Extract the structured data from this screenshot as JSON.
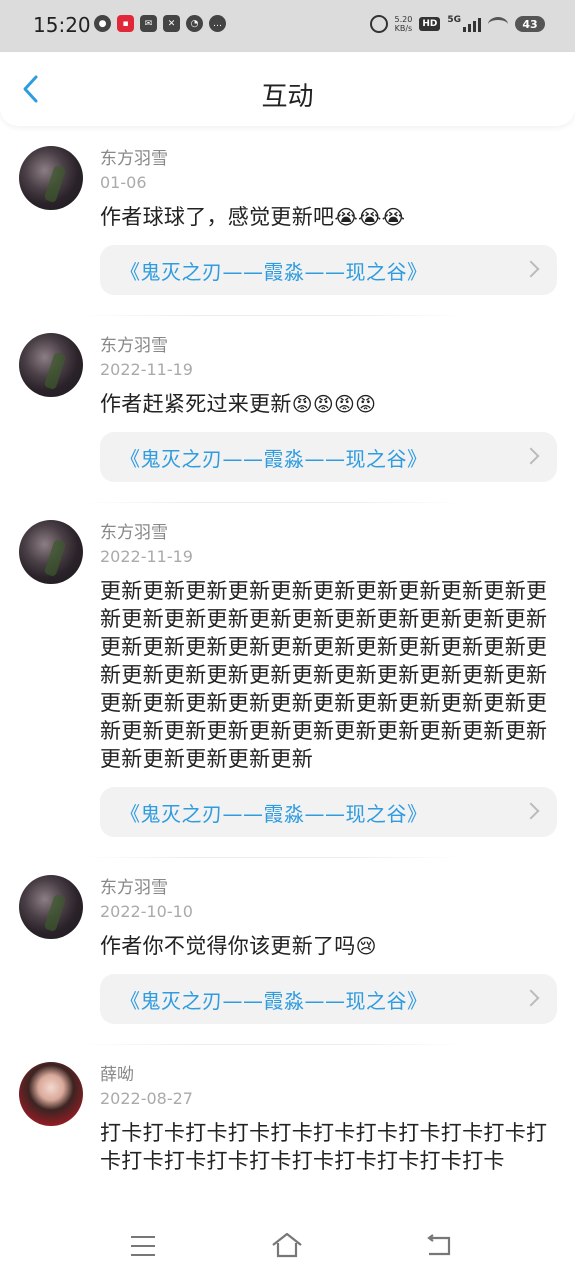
{
  "status": {
    "time": "15:20",
    "speed_value": "5.20",
    "speed_unit": "KB/s",
    "hd": "HD",
    "network": "5G",
    "battery": "43"
  },
  "header": {
    "title": "互动"
  },
  "comments": [
    {
      "username": "东方羽雪",
      "date": "01-06",
      "text": "作者球球了，感觉更新吧",
      "emoji": "😭😭😭",
      "book": "《鬼灭之刃——霞淼——现之谷》"
    },
    {
      "username": "东方羽雪",
      "date": "2022-11-19",
      "text": "作者赶紧死过来更新",
      "emoji": "😡😡😡😡",
      "book": "《鬼灭之刃——霞淼——现之谷》"
    },
    {
      "username": "东方羽雪",
      "date": "2022-11-19",
      "text": "更新更新更新更新更新更新更新更新更新更新更新更新更新更新更新更新更新更新更新更新更新更新更新更新更新更新更新更新更新更新更新更新更新更新更新更新更新更新更新更新更新更新更新更新更新更新更新更新更新更新更新更新更新更新更新更新更新更新更新更新更新更新更新更新更新更新更新更新",
      "emoji": "",
      "book": "《鬼灭之刃——霞淼——现之谷》"
    },
    {
      "username": "东方羽雪",
      "date": "2022-10-10",
      "text": "作者你不觉得你该更新了吗",
      "emoji": "😢",
      "book": "《鬼灭之刃——霞淼——现之谷》"
    },
    {
      "username": "薛呦",
      "date": "2022-08-27",
      "text": "打卡打卡打卡打卡打卡打卡打卡打卡打卡打卡打卡打卡打卡打卡打卡打卡打卡打卡打卡打卡",
      "emoji": ""
    }
  ]
}
